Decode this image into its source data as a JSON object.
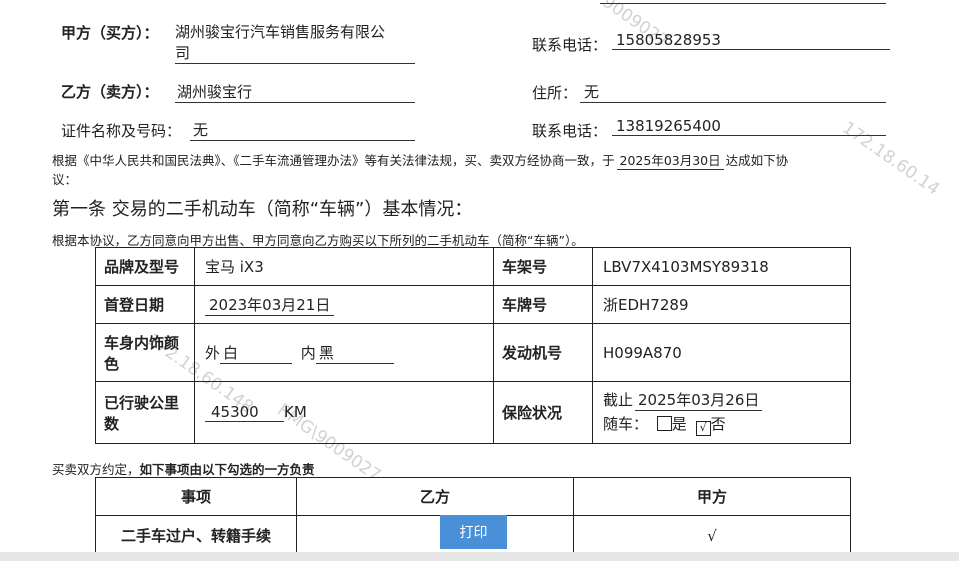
{
  "buyer": {
    "label": "甲方（买方）：",
    "value_line1": "湖州骏宝行汽车销售服务有限公",
    "value_line2": "司"
  },
  "buyer_phone": {
    "label": "联系电话：",
    "value": "15805828953"
  },
  "seller": {
    "label": "乙方（卖方）：",
    "value": "湖州骏宝行"
  },
  "seller_address": {
    "label": "住所：",
    "value": "无"
  },
  "id_doc": {
    "label": "证件名称及号码：",
    "value": "无"
  },
  "seller_phone": {
    "label": "联系电话：",
    "value": "13819265400"
  },
  "intro": {
    "line1_a": "根据《中华人民共和国民法典》、《二手车流通管理办法》等有关法律法规，买、卖双方经协商一致，于",
    "date": "2025年03月30日",
    "line1_b": "达成如下协",
    "line2": "议："
  },
  "section1_title": "第一条 交易的二手机动车（简称“车辆”）基本情况：",
  "section1_desc": "根据本协议，乙方同意向甲方出售、甲方同意向乙方购买以下所列的二手机动车（简称“车辆”）。",
  "vehicle": {
    "brand_label": "品牌及型号",
    "brand_value": "宝马 iX3",
    "vin_label": "车架号",
    "vin_value": "LBV7X4103MSY89318",
    "regdate_label": "首登日期",
    "regdate_value": "2023年03月21日",
    "plate_label": "车牌号",
    "plate_value": "浙EDH7289",
    "color_label_1": "车身内饰颜",
    "color_label_2": "色",
    "ext_prefix": "外",
    "ext_value": "白",
    "int_prefix": "内",
    "int_value": "黑",
    "engine_label": "发动机号",
    "engine_value": "H099A870",
    "mileage_label_1": "已行驶公里",
    "mileage_label_2": "数",
    "mileage_value": "45300",
    "mileage_unit": "KM",
    "insurance_label": "保险状况",
    "insurance_prefix": "截止",
    "insurance_date": "2025年03月26日",
    "insurance_with_car": "随车：",
    "yes": "是",
    "no": "否",
    "checked_mark": "√"
  },
  "agreement": {
    "text_a": "买卖双方约定，",
    "text_b": "如下事项由以下勾选的一方负责"
  },
  "resp_table": {
    "headers": [
      "事项",
      "乙方",
      "甲方"
    ],
    "row1": {
      "item": "二手车过户、转籍手续",
      "party_a_mark": "√"
    }
  },
  "print_button": "打印",
  "watermarks": [
    "172.18.60.148",
    "RMG\\9009027",
    "172.18.60.14",
    "9009027"
  ]
}
